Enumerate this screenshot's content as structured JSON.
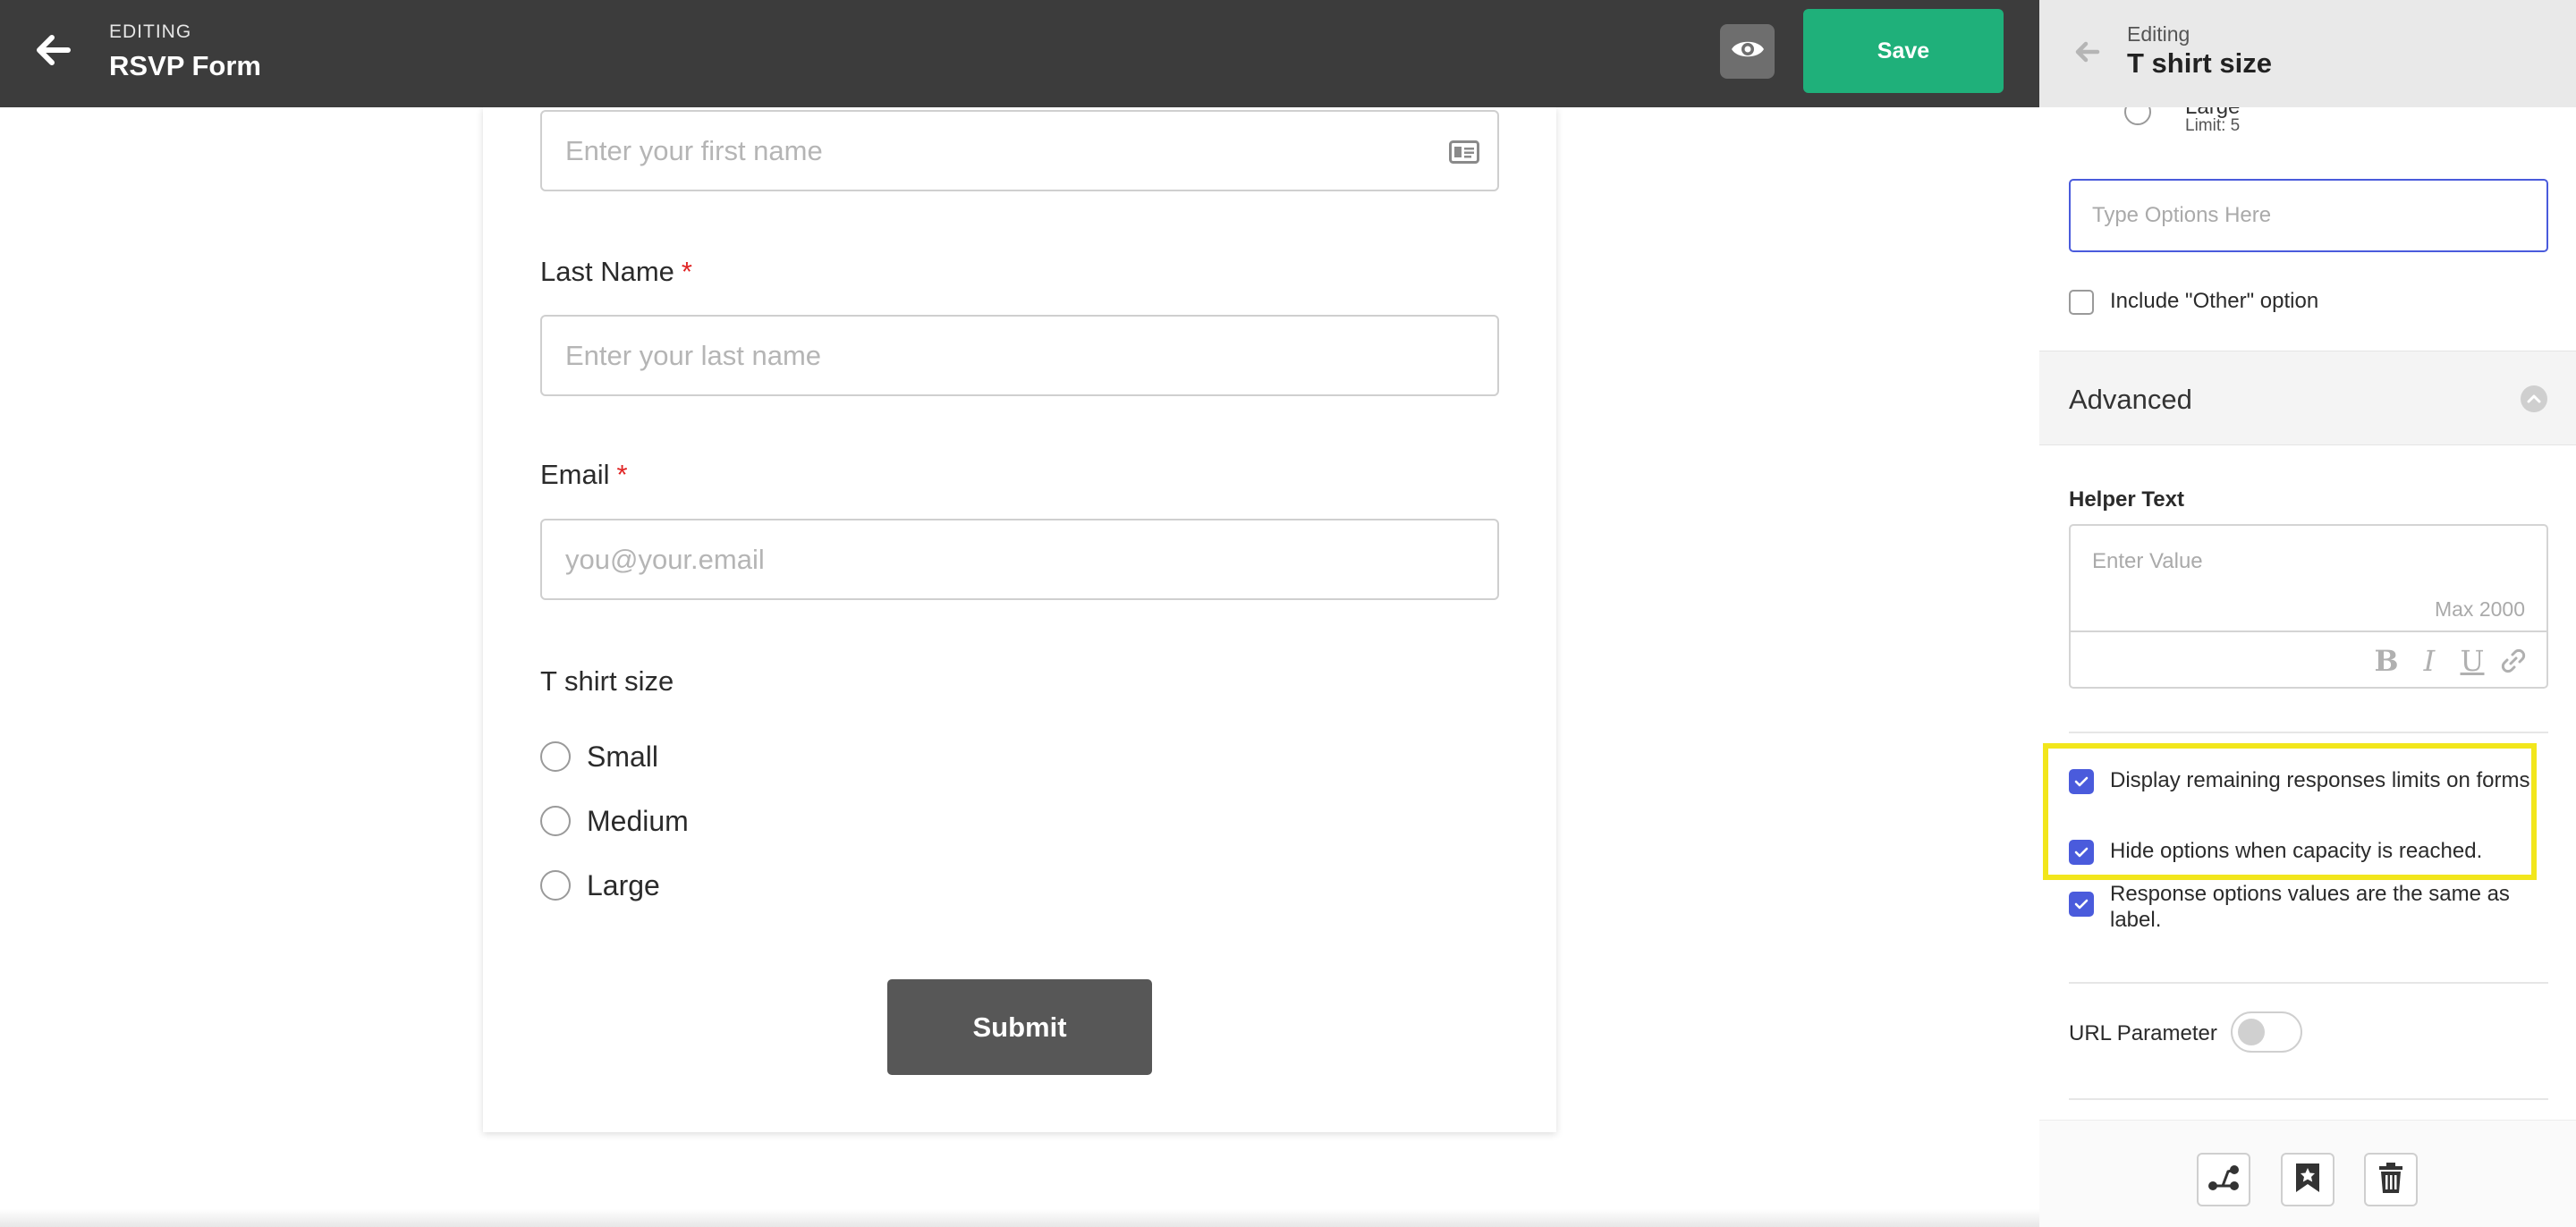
{
  "topbar": {
    "editing_label": "EDITING",
    "form_title": "RSVP Form",
    "save_label": "Save",
    "back_icon": "arrow-left-icon",
    "preview_icon": "eye-icon"
  },
  "form": {
    "first_name": {
      "placeholder": "Enter your first name",
      "icon": "contact-card-icon"
    },
    "last_name": {
      "label": "Last Name",
      "required_mark": "*",
      "placeholder": "Enter your last name"
    },
    "email": {
      "label": "Email",
      "required_mark": "*",
      "placeholder": "you@your.email"
    },
    "tshirt": {
      "label": "T shirt size",
      "options": [
        {
          "label": "Small"
        },
        {
          "label": "Medium"
        },
        {
          "label": "Large"
        }
      ]
    },
    "submit_label": "Submit"
  },
  "panel": {
    "editing_label": "Editing",
    "title": "T shirt size",
    "partial_option": {
      "label": "Large",
      "limit": "Limit: 5"
    },
    "options_input_placeholder": "Type Options Here",
    "include_other": {
      "label": "Include \"Other\" option",
      "checked": false
    },
    "advanced": {
      "title": "Advanced",
      "helper_label": "Helper Text",
      "helper_placeholder": "Enter Value",
      "helper_max": "Max 2000",
      "toolbar": [
        "bold-icon",
        "italic-icon",
        "underline-icon",
        "link-icon"
      ]
    },
    "checks": [
      {
        "label": "Display remaining responses limits on forms.",
        "checked": true
      },
      {
        "label": "Hide options when capacity is reached.",
        "checked": true
      },
      {
        "label": "Response options values are the same as label.",
        "checked": true
      }
    ],
    "url_parameter": {
      "label": "URL Parameter",
      "enabled": false
    },
    "footer_icons": [
      "logic-branch-icon",
      "bookmark-star-icon",
      "trash-icon"
    ]
  },
  "colors": {
    "topbar": "#3c3c3c",
    "save": "#1fb07a",
    "accent": "#4a5bdc",
    "required": "#e02424",
    "highlight": "#f2e61c",
    "submit": "#575757"
  }
}
